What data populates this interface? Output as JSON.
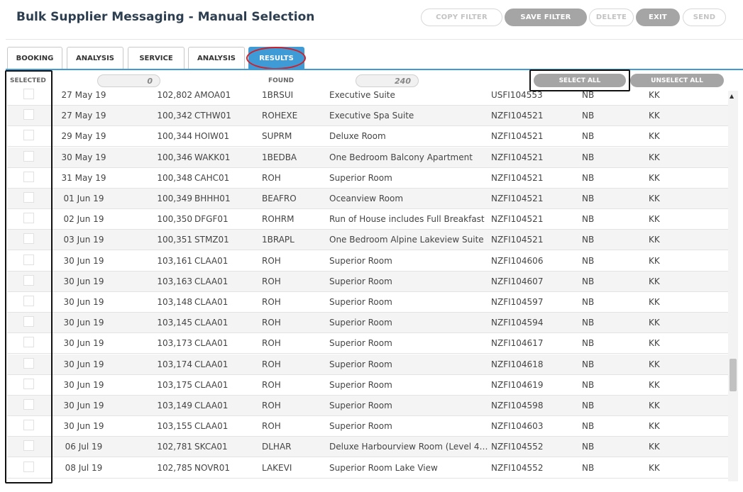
{
  "title": "Bulk Supplier Messaging - Manual Selection",
  "toolbar": {
    "copy_filter": "COPY FILTER",
    "save_filter": "SAVE FILTER",
    "delete": "DELETE",
    "exit": "EXIT",
    "send": "SEND"
  },
  "tabs": [
    "BOOKING",
    "ANALYSIS",
    "SERVICE",
    "ANALYSIS",
    "RESULTS"
  ],
  "active_tab": "RESULTS",
  "results_header": {
    "selected_label": "SELECTED",
    "selected_count": "0",
    "found_label": "FOUND",
    "found_count": "240",
    "select_all": "SELECT ALL",
    "unselect_all": "UNSELECT ALL"
  },
  "rows": [
    {
      "date": "27 May 19",
      "number": "102,802",
      "supplier": "AMOA01",
      "code": "1BRSUI",
      "description": "Executive Suite",
      "ref": "USFI104553",
      "status1": "NB",
      "status2": "KK"
    },
    {
      "date": "27 May 19",
      "number": "100,342",
      "supplier": "CTHW01",
      "code": "ROHEXE",
      "description": "Executive Spa Suite",
      "ref": "NZFI104521",
      "status1": "NB",
      "status2": "KK"
    },
    {
      "date": "29 May 19",
      "number": "100,344",
      "supplier": "HOIW01",
      "code": "SUPRM",
      "description": "Deluxe Room",
      "ref": "NZFI104521",
      "status1": "NB",
      "status2": "KK"
    },
    {
      "date": "30 May 19",
      "number": "100,346",
      "supplier": "WAKK01",
      "code": "1BEDBA",
      "description": "One Bedroom Balcony Apartment",
      "ref": "NZFI104521",
      "status1": "NB",
      "status2": "KK"
    },
    {
      "date": "31 May 19",
      "number": "100,348",
      "supplier": "CAHC01",
      "code": "ROH",
      "description": "Superior Room",
      "ref": "NZFI104521",
      "status1": "NB",
      "status2": "KK"
    },
    {
      "date": "01 Jun 19",
      "number": "100,349",
      "supplier": "BHHH01",
      "code": "BEAFRO",
      "description": "Oceanview Room",
      "ref": "NZFI104521",
      "status1": "NB",
      "status2": "KK"
    },
    {
      "date": "02 Jun 19",
      "number": "100,350",
      "supplier": "DFGF01",
      "code": "ROHRM",
      "description": "Run of House includes Full Breakfast",
      "ref": "NZFI104521",
      "status1": "NB",
      "status2": "KK"
    },
    {
      "date": "03 Jun 19",
      "number": "100,351",
      "supplier": "STMZ01",
      "code": "1BRAPL",
      "description": "One Bedroom Alpine Lakeview Suite",
      "ref": "NZFI104521",
      "status1": "NB",
      "status2": "KK"
    },
    {
      "date": "30 Jun 19",
      "number": "103,161",
      "supplier": "CLAA01",
      "code": "ROH",
      "description": "Superior Room",
      "ref": "NZFI104606",
      "status1": "NB",
      "status2": "KK"
    },
    {
      "date": "30 Jun 19",
      "number": "103,163",
      "supplier": "CLAA01",
      "code": "ROH",
      "description": "Superior Room",
      "ref": "NZFI104607",
      "status1": "NB",
      "status2": "KK"
    },
    {
      "date": "30 Jun 19",
      "number": "103,148",
      "supplier": "CLAA01",
      "code": "ROH",
      "description": "Superior Room",
      "ref": "NZFI104597",
      "status1": "NB",
      "status2": "KK"
    },
    {
      "date": "30 Jun 19",
      "number": "103,145",
      "supplier": "CLAA01",
      "code": "ROH",
      "description": "Superior Room",
      "ref": "NZFI104594",
      "status1": "NB",
      "status2": "KK"
    },
    {
      "date": "30 Jun 19",
      "number": "103,173",
      "supplier": "CLAA01",
      "code": "ROH",
      "description": "Superior Room",
      "ref": "NZFI104617",
      "status1": "NB",
      "status2": "KK"
    },
    {
      "date": "30 Jun 19",
      "number": "103,174",
      "supplier": "CLAA01",
      "code": "ROH",
      "description": "Superior Room",
      "ref": "NZFI104618",
      "status1": "NB",
      "status2": "KK"
    },
    {
      "date": "30 Jun 19",
      "number": "103,175",
      "supplier": "CLAA01",
      "code": "ROH",
      "description": "Superior Room",
      "ref": "NZFI104619",
      "status1": "NB",
      "status2": "KK"
    },
    {
      "date": "30 Jun 19",
      "number": "103,149",
      "supplier": "CLAA01",
      "code": "ROH",
      "description": "Superior Room",
      "ref": "NZFI104598",
      "status1": "NB",
      "status2": "KK"
    },
    {
      "date": "30 Jun 19",
      "number": "103,155",
      "supplier": "CLAA01",
      "code": "ROH",
      "description": "Superior Room",
      "ref": "NZFI104603",
      "status1": "NB",
      "status2": "KK"
    },
    {
      "date": "06 Jul 19",
      "number": "102,781",
      "supplier": "SKCA01",
      "code": "DLHAR",
      "description": "Deluxe Harbourview Room (Level 4 ...",
      "ref": "NZFI104552",
      "status1": "NB",
      "status2": "KK"
    },
    {
      "date": "08 Jul 19",
      "number": "102,785",
      "supplier": "NOVR01",
      "code": "LAKEVI",
      "description": "Superior Room Lake View",
      "ref": "NZFI104552",
      "status1": "NB",
      "status2": "KK"
    }
  ],
  "colors": {
    "accent": "#3e9bd6",
    "button_grey": "#a5a5a5",
    "highlight_ring": "#d0202a"
  },
  "icons": {
    "scroll_up": "scroll-up-arrow-icon"
  }
}
